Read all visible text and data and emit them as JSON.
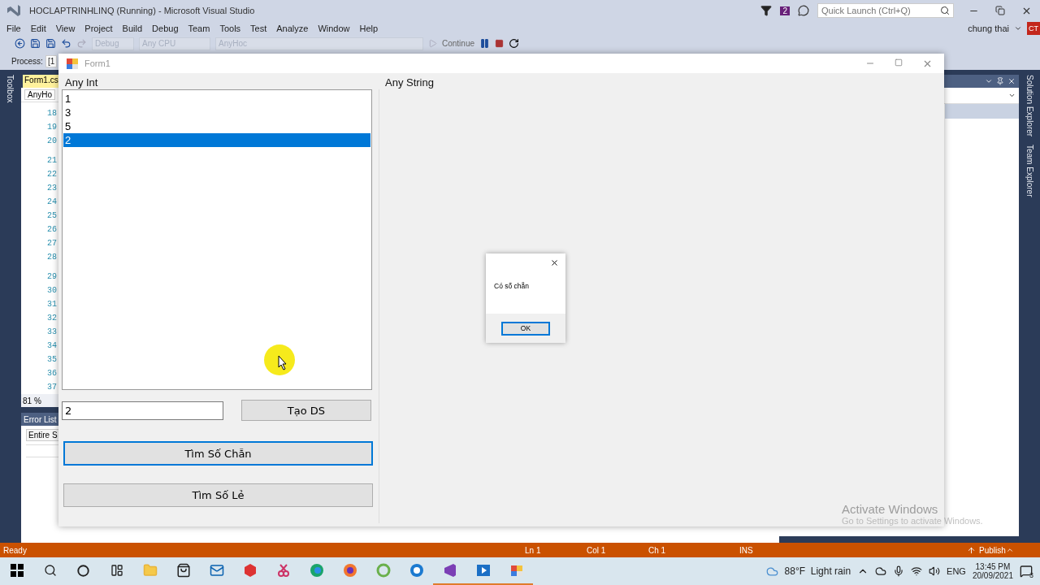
{
  "vs_window": {
    "title": "HOCLAPTRINHLINQ (Running) - Microsoft Visual Studio",
    "notification_count": "2",
    "quick_launch": {
      "placeholder": "Quick Launch (Ctrl+Q)"
    },
    "account": {
      "name": "chung thai",
      "initials": "CT"
    }
  },
  "menu": [
    "File",
    "Edit",
    "View",
    "Project",
    "Build",
    "Debug",
    "Team",
    "Tools",
    "Test",
    "Analyze",
    "Window",
    "Help"
  ],
  "toolbar": {
    "combos": [
      {
        "label": "Debug",
        "disabled": true
      },
      {
        "label": "Any CPU",
        "disabled": true
      },
      {
        "label": "AnyHoc",
        "disabled": true
      }
    ],
    "continue_label": "Continue"
  },
  "process": {
    "label": "Process:",
    "value": "[1"
  },
  "toolbox_label": "Toolbox",
  "editor": {
    "tab": {
      "label": "Form1.cs",
      "selected": true
    },
    "member_combo": "AnyHo",
    "line_groups": [
      [
        "18",
        "19",
        "20"
      ],
      [
        "21",
        "22",
        "23",
        "24",
        "25",
        "26",
        "27",
        "28"
      ],
      [
        "29",
        "30",
        "31",
        "32",
        "33",
        "34",
        "35",
        "36",
        "37"
      ]
    ],
    "zoom": "81 %"
  },
  "error_list": {
    "title": "Error List",
    "scope": "Entire S"
  },
  "side_tabs": [
    "Solution Explorer",
    "Team Explorer"
  ],
  "form": {
    "title": "Form1",
    "left_label": "Any Int",
    "right_label": "Any String",
    "list_items": [
      {
        "text": "1",
        "selected": false
      },
      {
        "text": "3",
        "selected": false
      },
      {
        "text": "5",
        "selected": false
      },
      {
        "text": "2",
        "selected": true
      }
    ],
    "input_value": "2",
    "buttons": [
      {
        "label": "Tạo DS",
        "focused": false
      },
      {
        "label": "Tìm Số Chẵn",
        "focused": true
      },
      {
        "label": "Tìm Số Lẻ",
        "focused": false
      }
    ]
  },
  "message_box": {
    "text": "Có số chẵn",
    "button": "OK"
  },
  "status_bar": {
    "state": "Ready",
    "line": "Ln 1",
    "column": "Col 1",
    "char": "Ch 1",
    "mode": "INS",
    "publish": "Publish"
  },
  "activation": {
    "title": "Activate Windows",
    "hint": "Go to Settings to activate Windows."
  },
  "taskbar": {
    "apps": [
      {
        "kind": "explorer",
        "running": false
      },
      {
        "kind": "store",
        "running": false
      },
      {
        "kind": "mail",
        "running": false
      },
      {
        "kind": "hex",
        "running": false
      },
      {
        "kind": "snip",
        "running": false
      },
      {
        "kind": "edge",
        "running": false
      },
      {
        "kind": "firefox",
        "running": false
      },
      {
        "kind": "spiral",
        "running": false
      },
      {
        "kind": "ring",
        "running": false
      },
      {
        "kind": "studio",
        "running": true
      },
      {
        "kind": "player",
        "running": true
      },
      {
        "kind": "form",
        "running": true
      }
    ],
    "weather": "88°F  Light rain",
    "language": "ENG",
    "time": "13:45 PM",
    "date": "20/09/2021",
    "notifications": "3"
  }
}
